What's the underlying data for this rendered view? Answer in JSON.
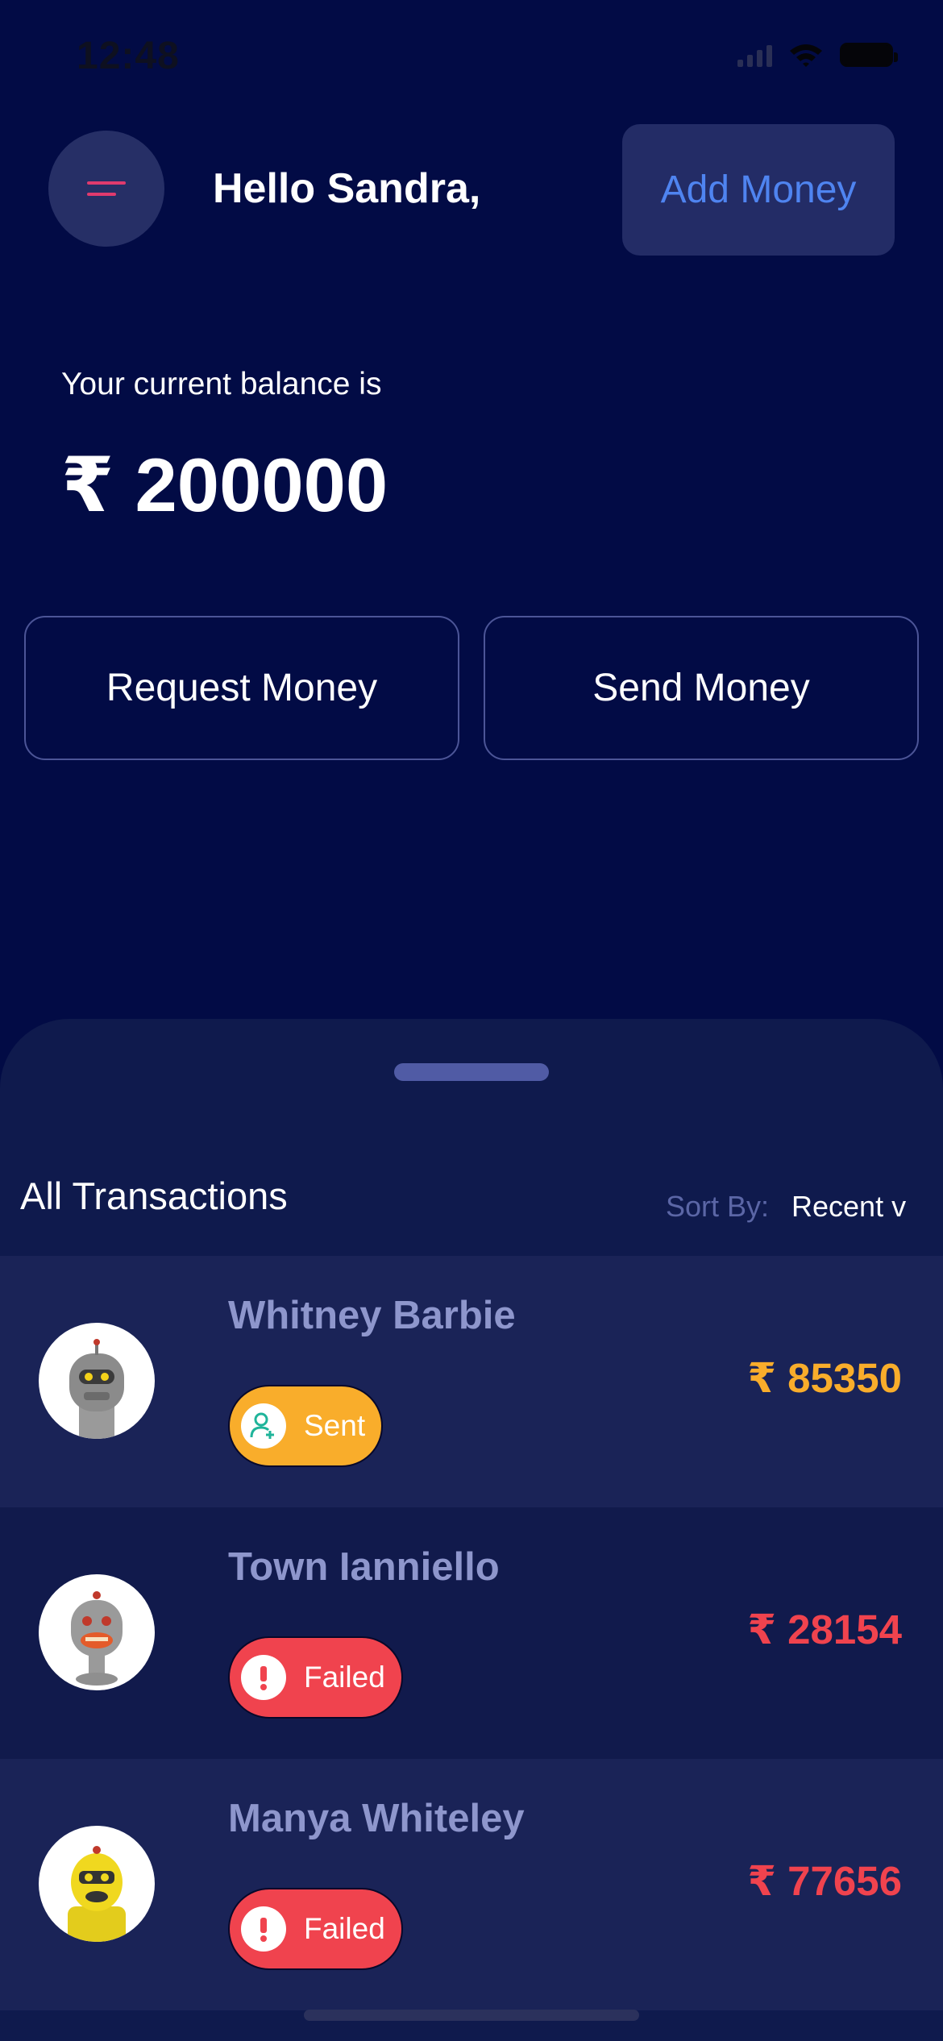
{
  "status_bar": {
    "time": "12:48"
  },
  "header": {
    "greeting": "Hello Sandra,",
    "add_money_label": "Add Money"
  },
  "balance": {
    "label": "Your current balance is",
    "amount": "₹ 200000"
  },
  "actions": {
    "request_label": "Request Money",
    "send_label": "Send Money"
  },
  "transactions": {
    "title": "All Transactions",
    "sort_label": "Sort By:",
    "sort_value": "Recent v",
    "items": [
      {
        "name": "Whitney Barbie",
        "status": "Sent",
        "amount": "₹ 85350",
        "status_color": "#f9ad2b",
        "avatar_icon": "robot-avatar-icon"
      },
      {
        "name": "Town Ianniello",
        "status": "Failed",
        "amount": "₹ 28154",
        "status_color": "#f0434e",
        "avatar_icon": "robot-avatar-icon"
      },
      {
        "name": "Manya Whiteley",
        "status": "Failed",
        "amount": "₹ 77656",
        "status_color": "#f0434e",
        "avatar_icon": "robot-avatar-icon"
      }
    ]
  },
  "colors": {
    "background": "#020b45",
    "sheet": "#0f1a4d",
    "accent_blue": "#4f84f0",
    "sent": "#f9ad2b",
    "failed": "#f0434e",
    "menu_accent": "#e03a6e"
  }
}
